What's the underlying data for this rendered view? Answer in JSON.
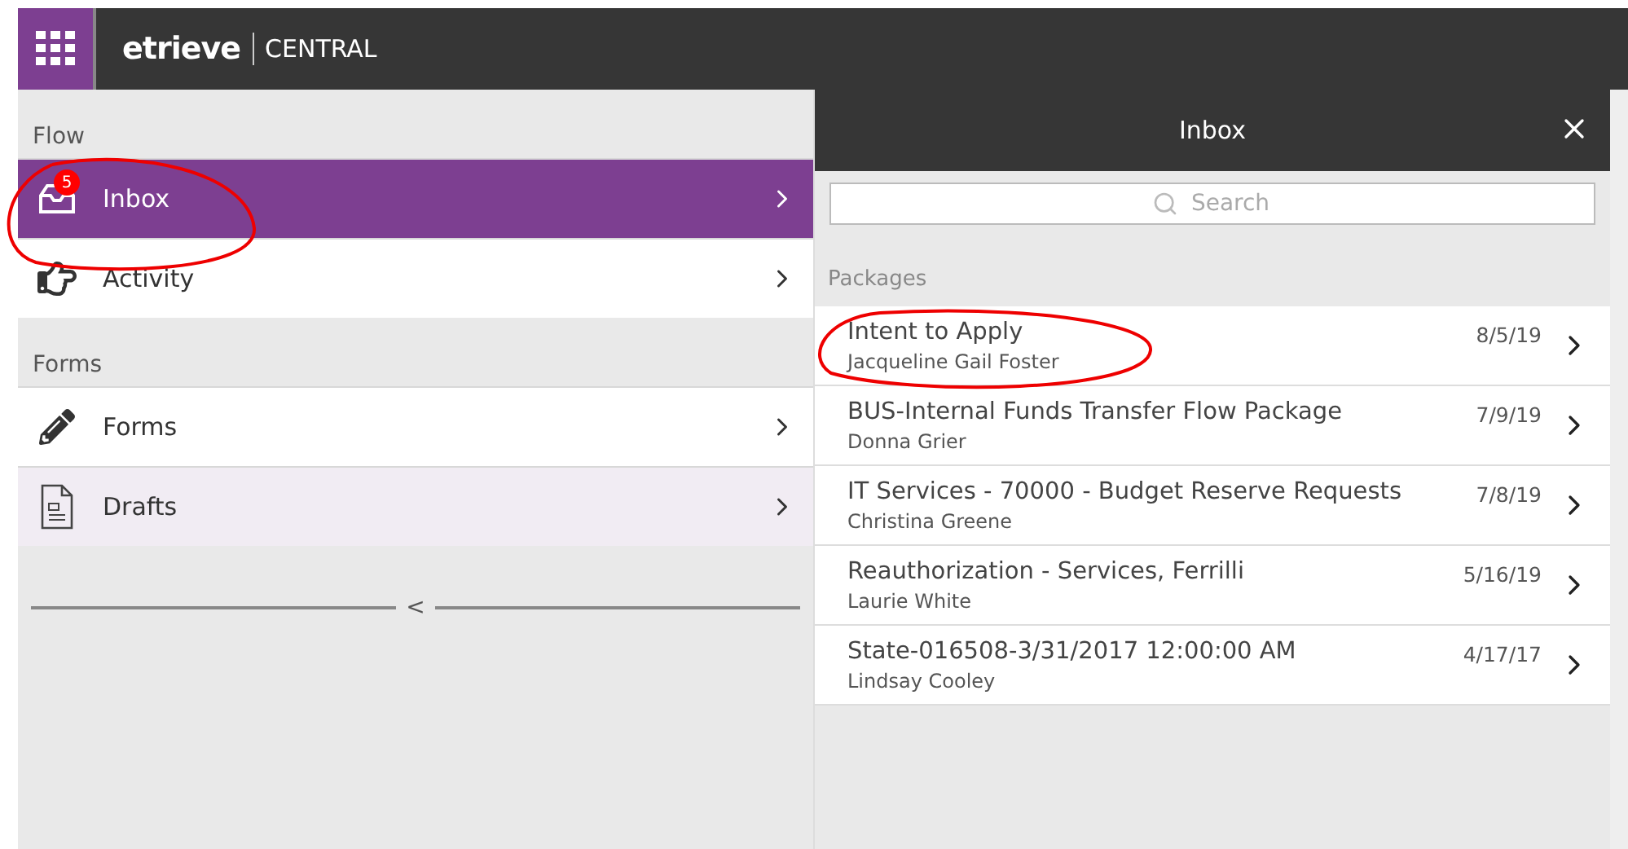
{
  "header": {
    "brand": "etrieve",
    "product": "CENTRAL"
  },
  "sidebar": {
    "sections": [
      {
        "title": "Flow",
        "items": [
          {
            "label": "Inbox",
            "kind": "inbox",
            "badge": "5",
            "selected": true,
            "hovered": false
          },
          {
            "label": "Activity",
            "kind": "hand",
            "selected": false,
            "hovered": false
          }
        ]
      },
      {
        "title": "Forms",
        "items": [
          {
            "label": "Forms",
            "kind": "pencil",
            "selected": false,
            "hovered": false
          },
          {
            "label": "Drafts",
            "kind": "document",
            "selected": false,
            "hovered": true
          }
        ]
      }
    ],
    "collapse": "<"
  },
  "panel": {
    "title": "Inbox",
    "search": {
      "placeholder": "Search"
    },
    "section": "Packages",
    "packages": [
      {
        "title": "Intent to Apply",
        "person": "Jacqueline Gail Foster",
        "date": "8/5/19"
      },
      {
        "title": "BUS-Internal Funds Transfer Flow Package",
        "person": "Donna Grier",
        "date": "7/9/19"
      },
      {
        "title": "IT Services - 70000 - Budget Reserve Requests",
        "person": "Christina Greene",
        "date": "7/8/19"
      },
      {
        "title": "Reauthorization - Services, Ferrilli",
        "person": "Laurie White",
        "date": "5/16/19"
      },
      {
        "title": "State-016508-3/31/2017 12:00:00 AM",
        "person": "Lindsay Cooley",
        "date": "4/17/17"
      }
    ]
  }
}
